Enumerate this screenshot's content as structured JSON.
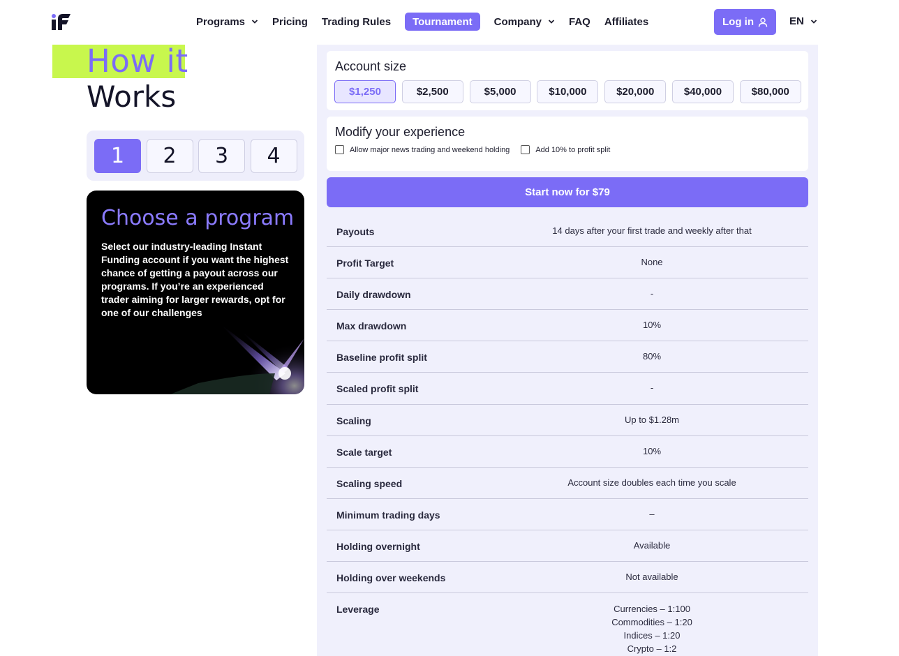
{
  "header": {
    "nav": [
      {
        "label": "Programs",
        "dropdown": true
      },
      {
        "label": "Pricing",
        "dropdown": false
      },
      {
        "label": "Trading Rules",
        "dropdown": false
      },
      {
        "label": "Tournament",
        "dropdown": false,
        "highlight": true
      },
      {
        "label": "Company",
        "dropdown": true
      },
      {
        "label": "FAQ",
        "dropdown": false
      },
      {
        "label": "Affiliates",
        "dropdown": false
      }
    ],
    "login_label": "Log in",
    "language": "EN"
  },
  "how": {
    "line1": "How it",
    "line2": "Works",
    "steps": [
      "1",
      "2",
      "3",
      "4"
    ],
    "active_step": "1"
  },
  "card": {
    "title": "Choose a program",
    "text": "Select our industry-leading Instant Funding account if you want the highest chance of getting a payout across our programs. If you’re an experienced trader aiming for larger rewards, opt for one of our challenges"
  },
  "account": {
    "title": "Account size",
    "sizes": [
      "$1,250",
      "$2,500",
      "$5,000",
      "$10,000",
      "$20,000",
      "$40,000",
      "$80,000"
    ],
    "selected": "$1,250"
  },
  "modify": {
    "title": "Modify your experience",
    "options": [
      {
        "label": "Allow major news trading and weekend holding",
        "checked": false
      },
      {
        "label": "Add 10% to profit split",
        "checked": false
      }
    ]
  },
  "start_label": "Start now for $79",
  "rules": [
    {
      "key": "Payouts",
      "value": "14 days after your first trade and weekly after that"
    },
    {
      "key": "Profit Target",
      "value": "None"
    },
    {
      "key": "Daily drawdown",
      "value": "-"
    },
    {
      "key": "Max drawdown",
      "value": "10%"
    },
    {
      "key": "Baseline profit split",
      "value": "80%"
    },
    {
      "key": "Scaled profit split",
      "value": "-"
    },
    {
      "key": "Scaling",
      "value": "Up to $1.28m"
    },
    {
      "key": "Scale target",
      "value": "10%"
    },
    {
      "key": "Scaling speed",
      "value": "Account size doubles each time you scale"
    },
    {
      "key": "Minimum trading days",
      "value": "–"
    },
    {
      "key": "Holding overnight",
      "value": "Available"
    },
    {
      "key": "Holding over weekends",
      "value": "Not available"
    }
  ],
  "leverage": {
    "key": "Leverage",
    "values": [
      "Currencies – 1:100",
      "Commodities – 1:20",
      "Indices – 1:20",
      "Crypto – 1:2"
    ]
  },
  "colors": {
    "accent": "#7b6cf6",
    "highlight": "#c8f74d",
    "panel": "#f0f0fc"
  }
}
